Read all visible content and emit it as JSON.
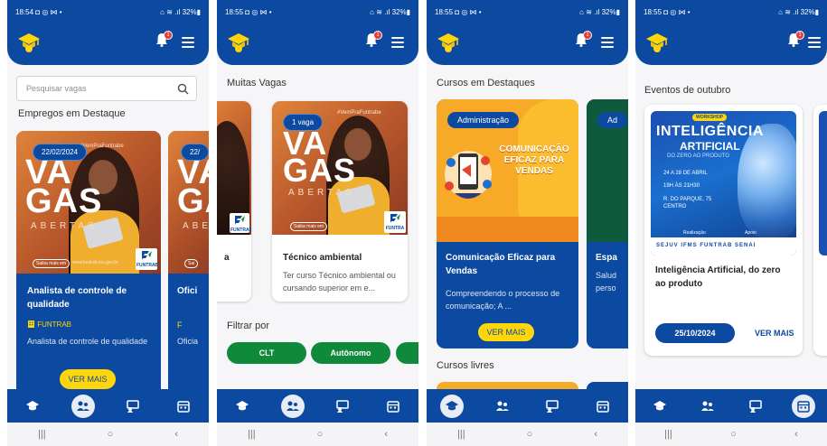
{
  "colors": {
    "primary": "#0b4aa0",
    "accent": "#ffd60a",
    "green": "#0f8a3b",
    "badge": "#e53935"
  },
  "phones": [
    {
      "status": {
        "time": "18:54",
        "left_icons": "◘ ◎ ⋈ •",
        "right": "⌂ ≋ .ıl 32%▮"
      },
      "notifications": "1"
    },
    {
      "status": {
        "time": "18:55",
        "left_icons": "◘ ◎ ⋈ •",
        "right": "⌂ ≋ .ıl 32%▮"
      },
      "notifications": "1"
    },
    {
      "status": {
        "time": "18:55",
        "left_icons": "◘ ◎ ⋈ •",
        "right": "⌂ ≋ .ıl 32%▮"
      },
      "notifications": "1"
    },
    {
      "status": {
        "time": "18:55",
        "left_icons": "◘ ◎ ⋈ •",
        "right": "⌂ ≋ .ıl 32%▮"
      },
      "notifications": "1"
    }
  ],
  "screen1": {
    "search_placeholder": "Pesquisar vagas",
    "section": "Empregos em Destaque",
    "card": {
      "date": "22/02/2024",
      "title": "Analista de controle de qualidade",
      "company": "FUNTRAB",
      "desc": "Analista de controle de qualidade",
      "btn": "VER MAIS"
    },
    "card2": {
      "date": "22/",
      "title": "Ofici",
      "company": "F",
      "desc": "Oficia"
    },
    "image": {
      "hashtag": "#VemPraFuntrabe",
      "vagas1": "VA",
      "vagas2": "GAS",
      "abertas": "ABERTAS",
      "saiba": "Saiba mais em",
      "site": "www.funtrab.ms.gov.br",
      "funtrab": "FUNTRAB",
      "sai": "Sai"
    }
  },
  "screen2": {
    "section": "Muitas Vagas",
    "card": {
      "pill": "1 vaga",
      "title": "Técnico ambiental",
      "desc": "Ter curso Técnico ambiental ou cursando superior em e..."
    },
    "card0": {
      "title": "a"
    },
    "image": {
      "hashtag": "#VemPraFuntrabe",
      "vagas1": "VA",
      "vagas2": "GAS",
      "abertas": "ABERTAS",
      "saiba": "Saiba mais em",
      "funtrab": "FUNTRAB",
      "funtrab_small": "FUNTRA"
    },
    "filter_label": "Filtrar por",
    "filters": [
      "CLT",
      "Autônomo"
    ]
  },
  "screen3": {
    "section": "Cursos em Destaques",
    "card": {
      "tag": "Administração",
      "img_text": "COMUNICAÇÃO EFICAZ PARA VENDAS",
      "title": "Comunicação Eficaz para Vendas",
      "desc": "Compreendendo o processo de comunicação; A ...",
      "btn": "VER MAIS"
    },
    "card2": {
      "tag": "Ad",
      "title": "Espa",
      "desc": "Salud perso"
    },
    "section2": "Cursos livres"
  },
  "screen4": {
    "section": "Eventos de outubro",
    "card": {
      "title": "Inteligência Artificial, do zero ao produto",
      "date": "25/10/2024",
      "link": "VER MAIS"
    },
    "poster": {
      "tag": "WORKSHOP",
      "line1": "INTELIGÊNCIA",
      "line2": "ARTIFICIAL",
      "line3": "DO ZERO AO PRODUTO",
      "date": "24 A 28 DE ABRIL",
      "time": "19H ÀS 21H30",
      "place": "R. DO PARQUE, 75 CENTRO",
      "realizacao": "Realização",
      "apoio": "Apoio",
      "sponsors": "SEJUV  IFMS  FUNTRAB  SENAI"
    }
  },
  "bottom_nav": [
    "graduation-cap-icon",
    "people-icon",
    "presentation-icon",
    "calendar-icon"
  ],
  "system_nav": {
    "recents": "|||",
    "home": "○",
    "back": "‹"
  }
}
